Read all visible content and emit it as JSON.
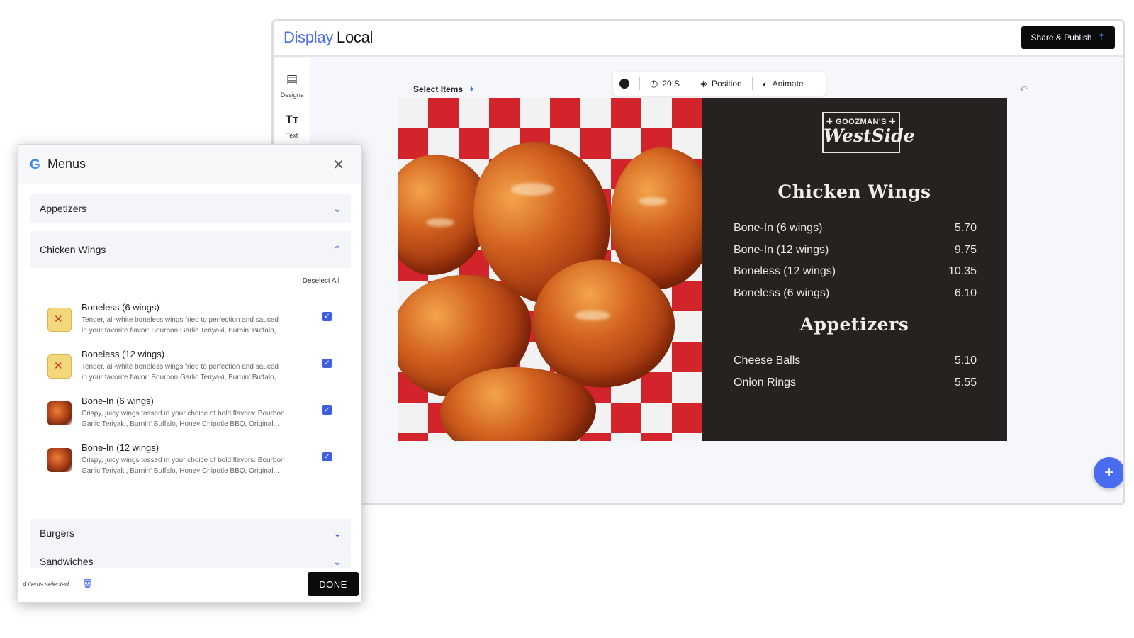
{
  "app": {
    "brand_part1": "Display",
    "brand_part2": "Local",
    "publish_label": "Share & Publish"
  },
  "rail": [
    {
      "label": "Designs"
    },
    {
      "label": "Text"
    }
  ],
  "canvas": {
    "select_items_label": "Select Items"
  },
  "toolbar": {
    "duration_label": "20 S",
    "position_label": "Position",
    "animate_label": "Animate"
  },
  "board": {
    "logo_top": "✚ GOOZMAN'S ✚",
    "logo_main": "WestSide",
    "sections": [
      {
        "title": "Chicken Wings",
        "items": [
          {
            "name": "Bone-In (6 wings)",
            "price": "5.70"
          },
          {
            "name": "Bone-In (12 wings)",
            "price": "9.75"
          },
          {
            "name": "Boneless (12 wings)",
            "price": "10.35"
          },
          {
            "name": "Boneless (6 wings)",
            "price": "6.10"
          }
        ]
      },
      {
        "title": "Appetizers",
        "items": [
          {
            "name": "Cheese Balls",
            "price": "5.10"
          },
          {
            "name": "Onion Rings",
            "price": "5.55"
          }
        ]
      }
    ]
  },
  "modal": {
    "title": "Menus",
    "categories": [
      "Appetizers",
      "Chicken Wings",
      "Burgers",
      "Sandwiches"
    ],
    "deselect_label": "Deselect All",
    "items": [
      {
        "name": "Boneless (6 wings)",
        "desc_line1": "Tender, all-white boneless wings fried to perfection and sauced",
        "desc_line2": "in your favorite flavor: Bourbon Garlic Teriyaki, Burnin' Buffalo,...",
        "checked": true
      },
      {
        "name": "Boneless (12 wings)",
        "desc_line1": "Tender, all-white boneless wings fried to perfection and sauced",
        "desc_line2": "in your favorite flavor: Bourbon Garlic Teriyaki, Burnin' Buffalo,...",
        "checked": true
      },
      {
        "name": "Bone-In (6 wings)",
        "desc_line1": "Crispy, juicy wings tossed in your choice of bold flavors: Bourbon",
        "desc_line2": "Garlic Teriyaki, Burnin' Buffalo, Honey Chipotle BBQ, Original...",
        "checked": true
      },
      {
        "name": "Bone-In (12 wings)",
        "desc_line1": "Crispy, juicy wings tossed in your choice of bold flavors: Bourbon",
        "desc_line2": "Garlic Teriyaki, Burnin' Buffalo, Honey Chipotle BBQ, Original...",
        "checked": true
      }
    ],
    "selected_count_label": "4 items selected",
    "done_label": "DONE"
  },
  "colors": {
    "accent": "#4a6cf1",
    "board_bg": "#252220",
    "checker_red": "#d3242b"
  },
  "icons": [
    "designs-icon",
    "text-icon",
    "sparkle-icon",
    "clock-icon",
    "layers-icon",
    "animate-icon",
    "undo-icon",
    "upload-icon",
    "plus-icon",
    "close-icon",
    "chevron-down-icon",
    "chevron-up-icon",
    "trash-icon",
    "google-icon",
    "checkbox-icon"
  ]
}
